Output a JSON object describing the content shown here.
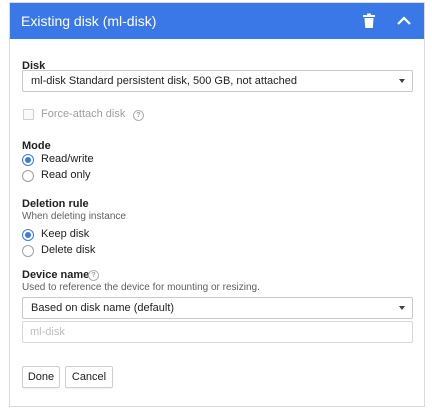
{
  "header": {
    "title": "Existing disk (ml-disk)",
    "bg_color": "#3b78e7",
    "icons": [
      "trash-icon",
      "chevron-up-icon"
    ]
  },
  "disk": {
    "label": "Disk",
    "selected": "ml-disk Standard persistent disk, 500 GB, not attached"
  },
  "force_attach": {
    "label": "Force-attach disk",
    "checked": false,
    "disabled": true
  },
  "mode": {
    "label": "Mode",
    "options": [
      {
        "label": "Read/write",
        "checked": true
      },
      {
        "label": "Read only",
        "checked": false
      }
    ]
  },
  "deletion_rule": {
    "label": "Deletion rule",
    "hint": "When deleting instance",
    "options": [
      {
        "label": "Keep disk",
        "checked": true
      },
      {
        "label": "Delete disk",
        "checked": false
      }
    ]
  },
  "device_name": {
    "label": "Device name",
    "hint": "Used to reference the device for mounting or resizing.",
    "selected": "Based on disk name (default)",
    "input_value": "ml-disk"
  },
  "buttons": {
    "done": "Done",
    "cancel": "Cancel"
  }
}
